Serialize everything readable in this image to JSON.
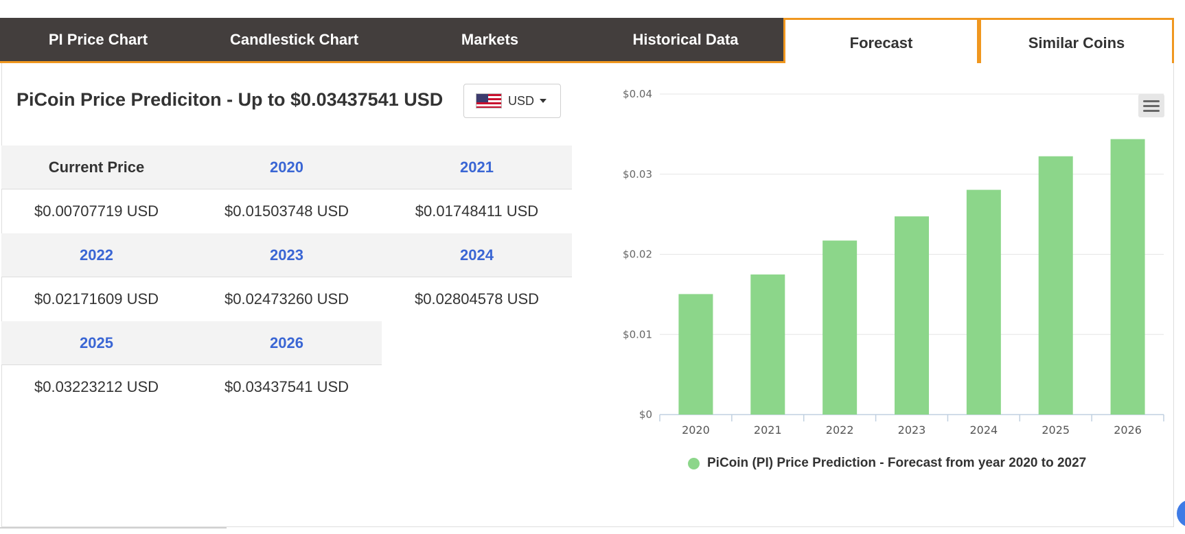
{
  "tabs": [
    {
      "label": "PI Price Chart",
      "active": false
    },
    {
      "label": "Candlestick Chart",
      "active": false
    },
    {
      "label": "Markets",
      "active": false
    },
    {
      "label": "Historical Data",
      "active": false
    },
    {
      "label": "Forecast",
      "active": true
    },
    {
      "label": "Similar Coins",
      "active": false
    }
  ],
  "heading": "PiCoin Price Prediciton - Up to $0.03437541 USD",
  "currency": {
    "label": "USD",
    "flag": "us-flag-icon"
  },
  "table": {
    "headers": [
      "Current Price",
      "2020",
      "2021",
      "2022",
      "2023",
      "2024",
      "2025",
      "2026"
    ],
    "values": [
      "$0.00707719 USD",
      "$0.01503748 USD",
      "$0.01748411 USD",
      "$0.02171609 USD",
      "$0.02473260 USD",
      "$0.02804578 USD",
      "$0.03223212 USD",
      "$0.03437541 USD"
    ]
  },
  "chart_data": {
    "type": "bar",
    "categories": [
      "2020",
      "2021",
      "2022",
      "2023",
      "2024",
      "2025",
      "2026"
    ],
    "series": [
      {
        "name": "PiCoin (PI) Price Prediction - Forecast from year 2020 to 2027",
        "values": [
          0.01503748,
          0.01748411,
          0.02171609,
          0.0247326,
          0.02804578,
          0.03223212,
          0.03437541
        ],
        "color": "#8cd68a"
      }
    ],
    "yticks": [
      "$0",
      "$0.01",
      "$0.02",
      "$0.03",
      "$0.04"
    ],
    "ylim": [
      0,
      0.04
    ],
    "grid": true,
    "legend": "bottom"
  },
  "colors": {
    "tab_bg": "#433e3d",
    "tab_accent": "#f0971f",
    "link_blue": "#3a66d4",
    "bar_green": "#8cd68a"
  }
}
